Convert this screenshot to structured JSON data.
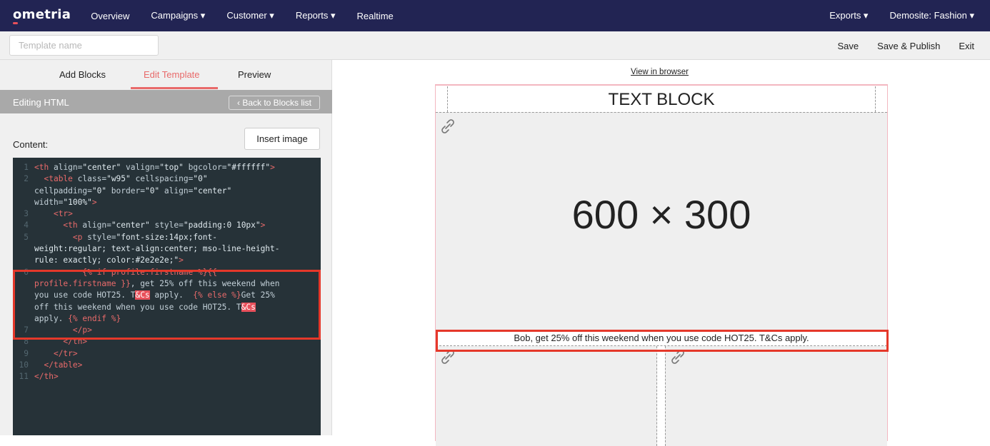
{
  "nav": {
    "logo": "ometria",
    "items": [
      "Overview",
      "Campaigns ▾",
      "Customer ▾",
      "Reports ▾",
      "Realtime"
    ],
    "right_items": [
      "Exports ▾",
      "Demosite: Fashion ▾"
    ]
  },
  "toolbar": {
    "template_name_placeholder": "Template name",
    "save": "Save",
    "save_publish": "Save & Publish",
    "exit": "Exit"
  },
  "left": {
    "tabs": [
      "Add Blocks",
      "Edit Template",
      "Preview"
    ],
    "active_tab": "Edit Template",
    "editing_title": "Editing HTML",
    "back_button": "‹ Back to Blocks list",
    "content_label": "Content:",
    "insert_image": "Insert image"
  },
  "code_lines": [
    "1",
    "2",
    "3",
    "4",
    "5",
    "6",
    "7",
    "8",
    "9",
    "10",
    "11"
  ],
  "preview": {
    "view_in_browser": "View in browser",
    "text_block": "TEXT BLOCK",
    "image_placeholder": "600 × 300",
    "promo_text": "Bob, get 25% off this weekend when you use code HOT25. T&Cs apply."
  },
  "colors": {
    "nav_bg": "#222453",
    "accent": "#e86a6a",
    "highlight_border": "#e5382a",
    "code_bg": "#263238"
  }
}
